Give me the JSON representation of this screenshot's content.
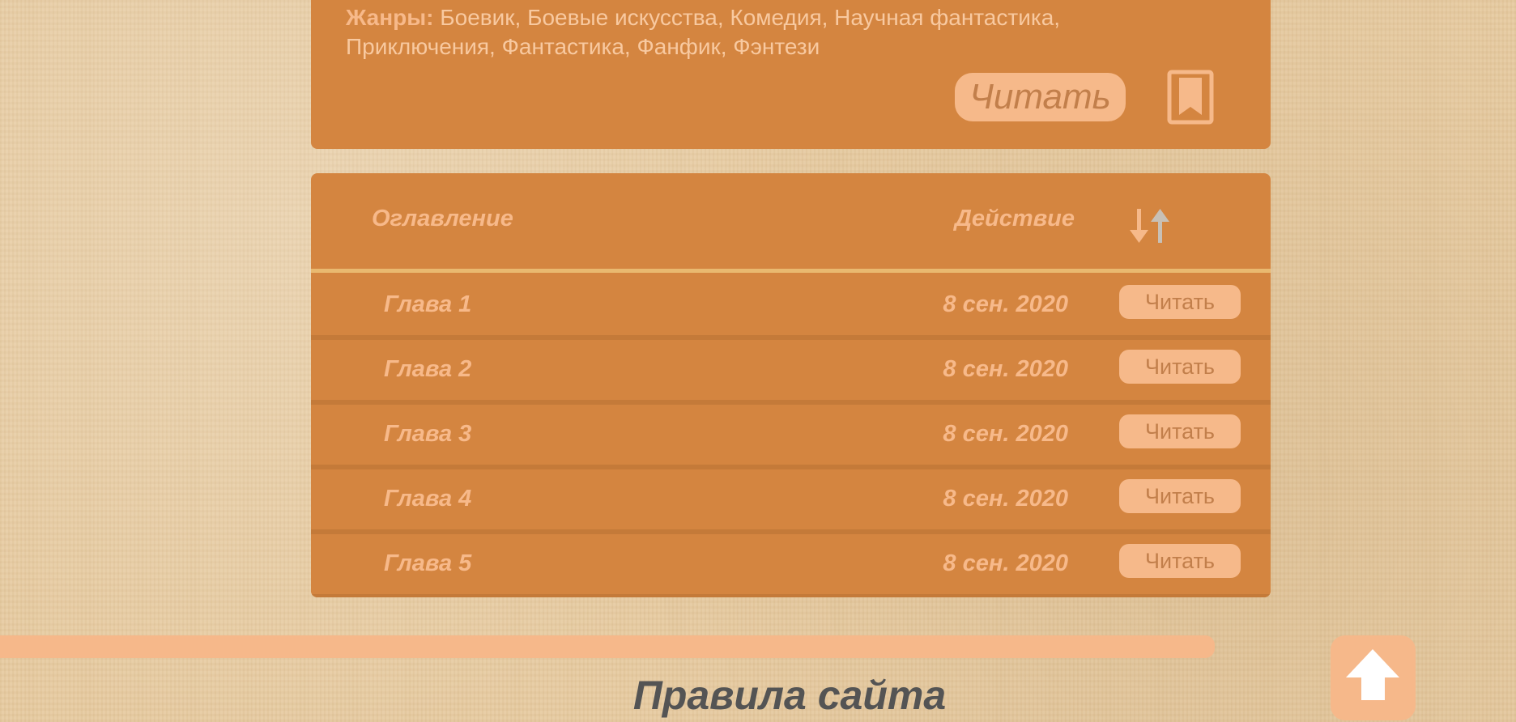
{
  "info": {
    "genres_label": "Жанры:",
    "genres_text": "Боевик, Боевые искусства, Комедия, Научная фантастика, Приключения, Фантастика, Фанфик, Фэнтези",
    "read_button": "Читать",
    "bookmark_icon": "bookmark-icon"
  },
  "contents": {
    "title": "Оглавление",
    "action": "Действие",
    "sort_icon": "sort-arrows-icon",
    "chapters": [
      {
        "title": "Глава 1",
        "date": "8 сен. 2020",
        "button": "Читать"
      },
      {
        "title": "Глава 2",
        "date": "8 сен. 2020",
        "button": "Читать"
      },
      {
        "title": "Глава 3",
        "date": "8 сен. 2020",
        "button": "Читать"
      },
      {
        "title": "Глава 4",
        "date": "8 сен. 2020",
        "button": "Читать"
      },
      {
        "title": "Глава 5",
        "date": "8 сен. 2020",
        "button": "Читать"
      }
    ]
  },
  "footer": {
    "rules_link": "Правила сайта",
    "scroll_top_icon": "arrow-up-icon"
  },
  "colors": {
    "panel": "#d48540",
    "accent": "#f6b98a",
    "text_light": "#f7b98a"
  }
}
